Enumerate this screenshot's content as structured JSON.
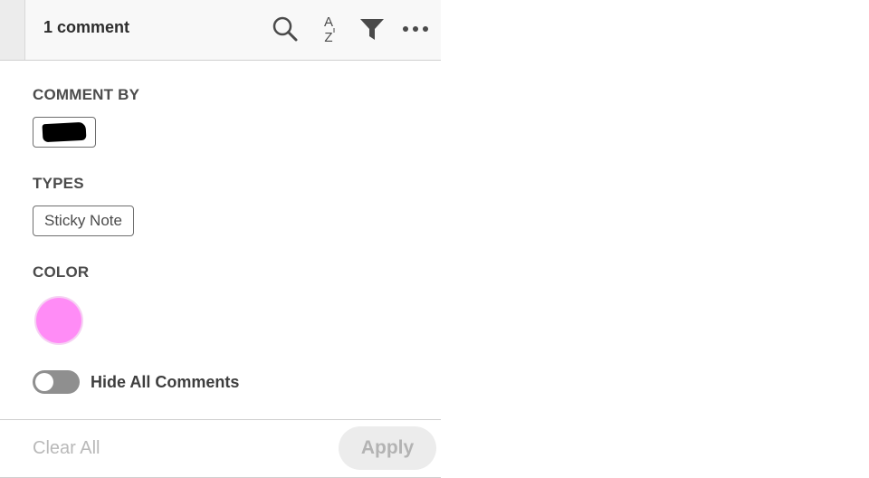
{
  "header": {
    "title": "1 comment",
    "icons": [
      "search-icon",
      "sort-az-icon",
      "filter-icon",
      "more-icon"
    ]
  },
  "filters": {
    "comment_by_label": "COMMENT BY",
    "types_label": "TYPES",
    "types_chip": "Sticky Note",
    "color_label": "COLOR",
    "color_value": "#ff8cf6",
    "hide_all_label": "Hide All Comments",
    "hide_all_on": false
  },
  "footer": {
    "clear_all": "Clear All",
    "apply": "Apply"
  }
}
